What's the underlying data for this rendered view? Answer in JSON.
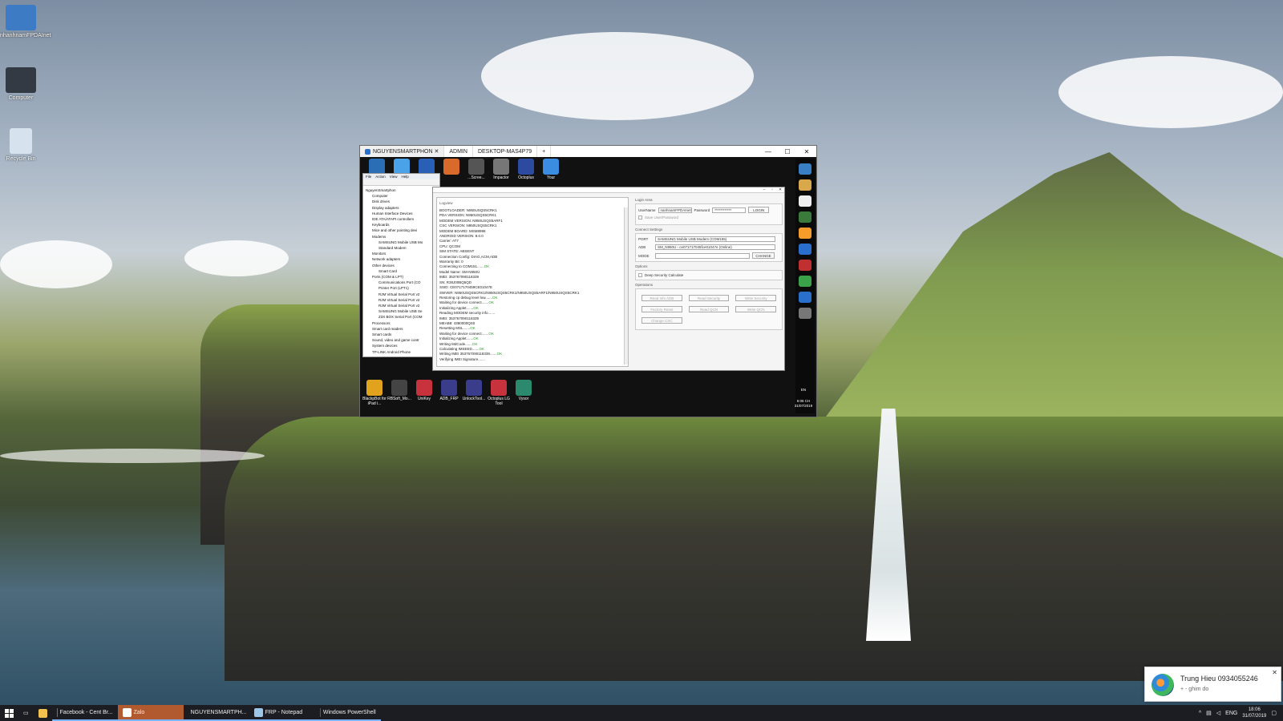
{
  "desktop": {
    "icons": [
      {
        "label": "nhanhnamFPDAInet",
        "color": "#3d7bc4"
      },
      {
        "label": "Computer",
        "color": "#333a44"
      },
      {
        "label": "Recycle Bin",
        "color": "#d6e3ef"
      }
    ]
  },
  "window": {
    "tabs": [
      "NGUYENSMARTPHON",
      "ADMIN",
      "DESKTOP-MAS4P79"
    ],
    "new_tab": "+",
    "controls": {
      "minimize": "—",
      "maximize": "☐",
      "close": "✕"
    }
  },
  "remote_top_icons": [
    {
      "label": "",
      "color": "#2a6fb6"
    },
    {
      "label": "",
      "color": "#4aa3e8"
    },
    {
      "label": "",
      "color": "#2a5fb6"
    },
    {
      "label": "",
      "color": "#d86a2a"
    },
    {
      "label": "...Scree...",
      "color": "#555"
    },
    {
      "label": "Impactor",
      "color": "#777"
    },
    {
      "label": "Octoplus",
      "color": "#2c4aa0"
    },
    {
      "label": "Your",
      "color": "#3a8de0"
    }
  ],
  "devmgr": {
    "menu": [
      "File",
      "Action",
      "View",
      "Help"
    ],
    "tree": [
      {
        "text": "NguyenSmartphon",
        "lvl": 0
      },
      {
        "text": "Computer",
        "lvl": 1
      },
      {
        "text": "Disk drives",
        "lvl": 1
      },
      {
        "text": "Display adapters",
        "lvl": 1
      },
      {
        "text": "Human Interface Devices",
        "lvl": 1
      },
      {
        "text": "IDE ATA/ATAPI controllers",
        "lvl": 1
      },
      {
        "text": "Keyboards",
        "lvl": 1
      },
      {
        "text": "Mice and other pointing devi",
        "lvl": 1
      },
      {
        "text": "Modems",
        "lvl": 1
      },
      {
        "text": "SAMSUNG Mobile USB Mo",
        "lvl": 2
      },
      {
        "text": "Standard Modem",
        "lvl": 2
      },
      {
        "text": "Monitors",
        "lvl": 1
      },
      {
        "text": "Network adapters",
        "lvl": 1
      },
      {
        "text": "Other devices",
        "lvl": 1
      },
      {
        "text": "Smart Card",
        "lvl": 2
      },
      {
        "text": "Ports (COM & LPT)",
        "lvl": 1
      },
      {
        "text": "Communications Port (CO",
        "lvl": 2
      },
      {
        "text": "Printer Port (LPT1)",
        "lvl": 2
      },
      {
        "text": "RJM Virtual Serial Port v2",
        "lvl": 2
      },
      {
        "text": "RJM Virtual Serial Port v2",
        "lvl": 2
      },
      {
        "text": "RJM Virtual Serial Port v2",
        "lvl": 2
      },
      {
        "text": "SAMSUNG Mobile USB Se",
        "lvl": 2
      },
      {
        "text": "Z3X BOX Serial Port (COM",
        "lvl": 2
      },
      {
        "text": "Processors",
        "lvl": 1
      },
      {
        "text": "Smart card readers",
        "lvl": 1
      },
      {
        "text": "Smart cards",
        "lvl": 1
      },
      {
        "text": "Sound, video and game contr",
        "lvl": 1
      },
      {
        "text": "System devices",
        "lvl": 1
      },
      {
        "text": "TP-LINK Android Phone",
        "lvl": 1
      }
    ]
  },
  "tool": {
    "log_label": "Logview",
    "log_lines": [
      {
        "t": "BOOTLOADER: N950USQS5CRK1",
        "ok": ""
      },
      {
        "t": "PDA VERSION: N950USQS5CRK1",
        "ok": ""
      },
      {
        "t": "MODEM VERSION: N950USQS5ARF1",
        "ok": ""
      },
      {
        "t": "CSC VERSION: N950USQS5CRK1",
        "ok": ""
      },
      {
        "t": "MODEM BOARD: MSM8998",
        "ok": ""
      },
      {
        "t": "ANDROID VERSION: 8.0.0",
        "ok": ""
      },
      {
        "t": "Carrier: AT7",
        "ok": ""
      },
      {
        "t": "CPU: QCOM",
        "ok": ""
      },
      {
        "t": "SIM STATE: ABSENT",
        "ok": ""
      },
      {
        "t": "Connection Config: DIAG,ACM,ADB",
        "ok": ""
      },
      {
        "t": "Warranty Bit: 0",
        "ok": ""
      },
      {
        "t": "Connecting to COM151.......",
        "ok": "OK"
      },
      {
        "t": "Model Name: SM-N950U",
        "ok": ""
      },
      {
        "t": "IMEI: 353767090118339",
        "ok": ""
      },
      {
        "t": "SN: R38J00BQ5QD",
        "ok": ""
      },
      {
        "t": "SSID: CE0717170459CE01047E",
        "ok": ""
      },
      {
        "t": "SWVER: N950USQS5CRK1/N950USQS5CRK1/N950USQS5ARF1/N950USQS5CRK1",
        "ok": ""
      },
      {
        "t": "Restoring cp debug level low.......",
        "ok": "OK"
      },
      {
        "t": "Waiting for device connect.......",
        "ok": "OK"
      },
      {
        "t": "Initializing Applet.......",
        "ok": "OK"
      },
      {
        "t": "Reading MODEM security info.......",
        "ok": ""
      },
      {
        "t": "IMEI: 353767090118339",
        "ok": ""
      },
      {
        "t": "MEAB8: 4380000QS0",
        "ok": ""
      },
      {
        "t": "Resetting MSL.......",
        "ok": "OK"
      },
      {
        "t": "Waiting for device connect.......",
        "ok": "OK"
      },
      {
        "t": "Initializing Applet.......",
        "ok": "OK"
      },
      {
        "t": "Writing MdCode.......",
        "ok": "OK"
      },
      {
        "t": "Calculating IMSEED.......",
        "ok": "OK"
      },
      {
        "t": "Writing IMEI 353767090118339.......",
        "ok": "OK"
      },
      {
        "t": "Verifying IMEI Signature.......",
        "ok": ""
      }
    ],
    "login": {
      "title": "Login Area",
      "username_label": "UserName",
      "username_value": "nanhnamFPDAInet",
      "password_label": "Password",
      "password_value": "************",
      "login_button": "LOGIN",
      "save_label": "Save User/Password"
    },
    "connect": {
      "title": "Connect Settings",
      "port_label": "PORT",
      "port_value": "SAMSUNG Mobile USB Modem (COM155)",
      "adb_label": "ADB",
      "adb_value": "SM_N950U - ce071717045fce01047e (Online)",
      "mode_label": "MODE",
      "mode_value": "",
      "change_button": "CHANGE"
    },
    "options": {
      "title": "Options",
      "deep_security": "Deep Security Calculate"
    },
    "operations": {
      "title": "Operations",
      "buttons": [
        "Read Info ADB",
        "Read Security",
        "Write Security",
        "Factory Reset",
        "Read QCN",
        "Write QCN",
        "Change CSC"
      ]
    }
  },
  "remote_bottom_icons": [
    {
      "label": "BlackpBot for iPad i...",
      "color": "#e1a31e"
    },
    {
      "label": "RBSoft_Mo...",
      "color": "#444"
    },
    {
      "label": "UniKey",
      "color": "#c8323c"
    },
    {
      "label": "ADB_FRP",
      "color": "#3a3d8c"
    },
    {
      "label": "UnlockTool...",
      "color": "#3a3d8c"
    },
    {
      "label": "Octoplus LG Tool",
      "color": "#c8323c"
    },
    {
      "label": "Vysor",
      "color": "#2b8a6e"
    }
  ],
  "remote_sidebar": {
    "icon_colors": [
      "#3a7fc4",
      "#d9a84a",
      "#eeeeee",
      "#3a7a3a",
      "#f59b2a",
      "#2a6fcc",
      "#c03030",
      "#3aa04a",
      "#2a6fcc",
      "#777777"
    ],
    "lang": "EN",
    "time": "6:06 CH",
    "date": "31/07/2019"
  },
  "notification": {
    "title": "Trung Hieu 0934055246",
    "subtitle": "+ - ghim do",
    "close": "✕"
  },
  "taskbar": {
    "apps": [
      {
        "label": "Facebook - Cent Br...",
        "color": "#3b7be0",
        "cls": ""
      },
      {
        "label": "Zalo",
        "color": "#ffffff",
        "cls": "zalo"
      },
      {
        "label": "NGUYENSMARTPH...",
        "color": "#3a8de0",
        "cls": ""
      },
      {
        "label": "FRP - Notepad",
        "color": "#9ec6e8",
        "cls": ""
      },
      {
        "label": "Windows PowerShell",
        "color": "#2a5fb6",
        "cls": ""
      }
    ],
    "lang": "ENG",
    "time": "18:06",
    "date": "31/07/2019"
  }
}
